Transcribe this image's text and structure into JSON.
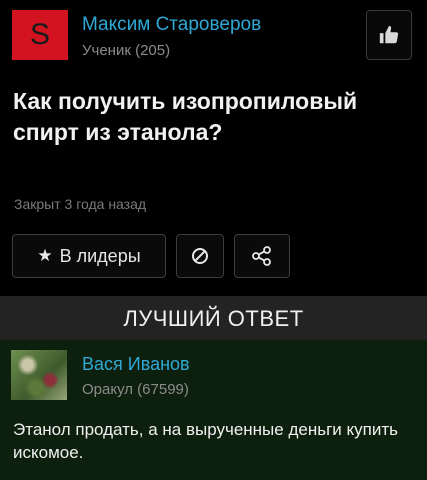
{
  "author": {
    "avatar_letter": "S",
    "name": "Максим Староверов",
    "rank": "Ученик (205)"
  },
  "question": {
    "title": "Как получить изопропиловый спирт из этанола?",
    "status": "Закрыт 3 года назад"
  },
  "actions": {
    "leaders_label": "В лидеры",
    "leaders_icon": "star-icon",
    "block_icon": "block-icon",
    "share_icon": "share-icon",
    "like_icon": "thumbs-up-icon"
  },
  "best_answer": {
    "header": "ЛУЧШИЙ ОТВЕТ",
    "author_name": "Вася Иванов",
    "author_rank": "Оракул (67599)",
    "text": "Этанол продать, а на вырученные деньги купить искомое."
  },
  "colors": {
    "background": "#000000",
    "link": "#2fa9d6",
    "avatar_red": "#d3131f",
    "answer_bg": "#0d200d",
    "header_bg": "#232323"
  }
}
